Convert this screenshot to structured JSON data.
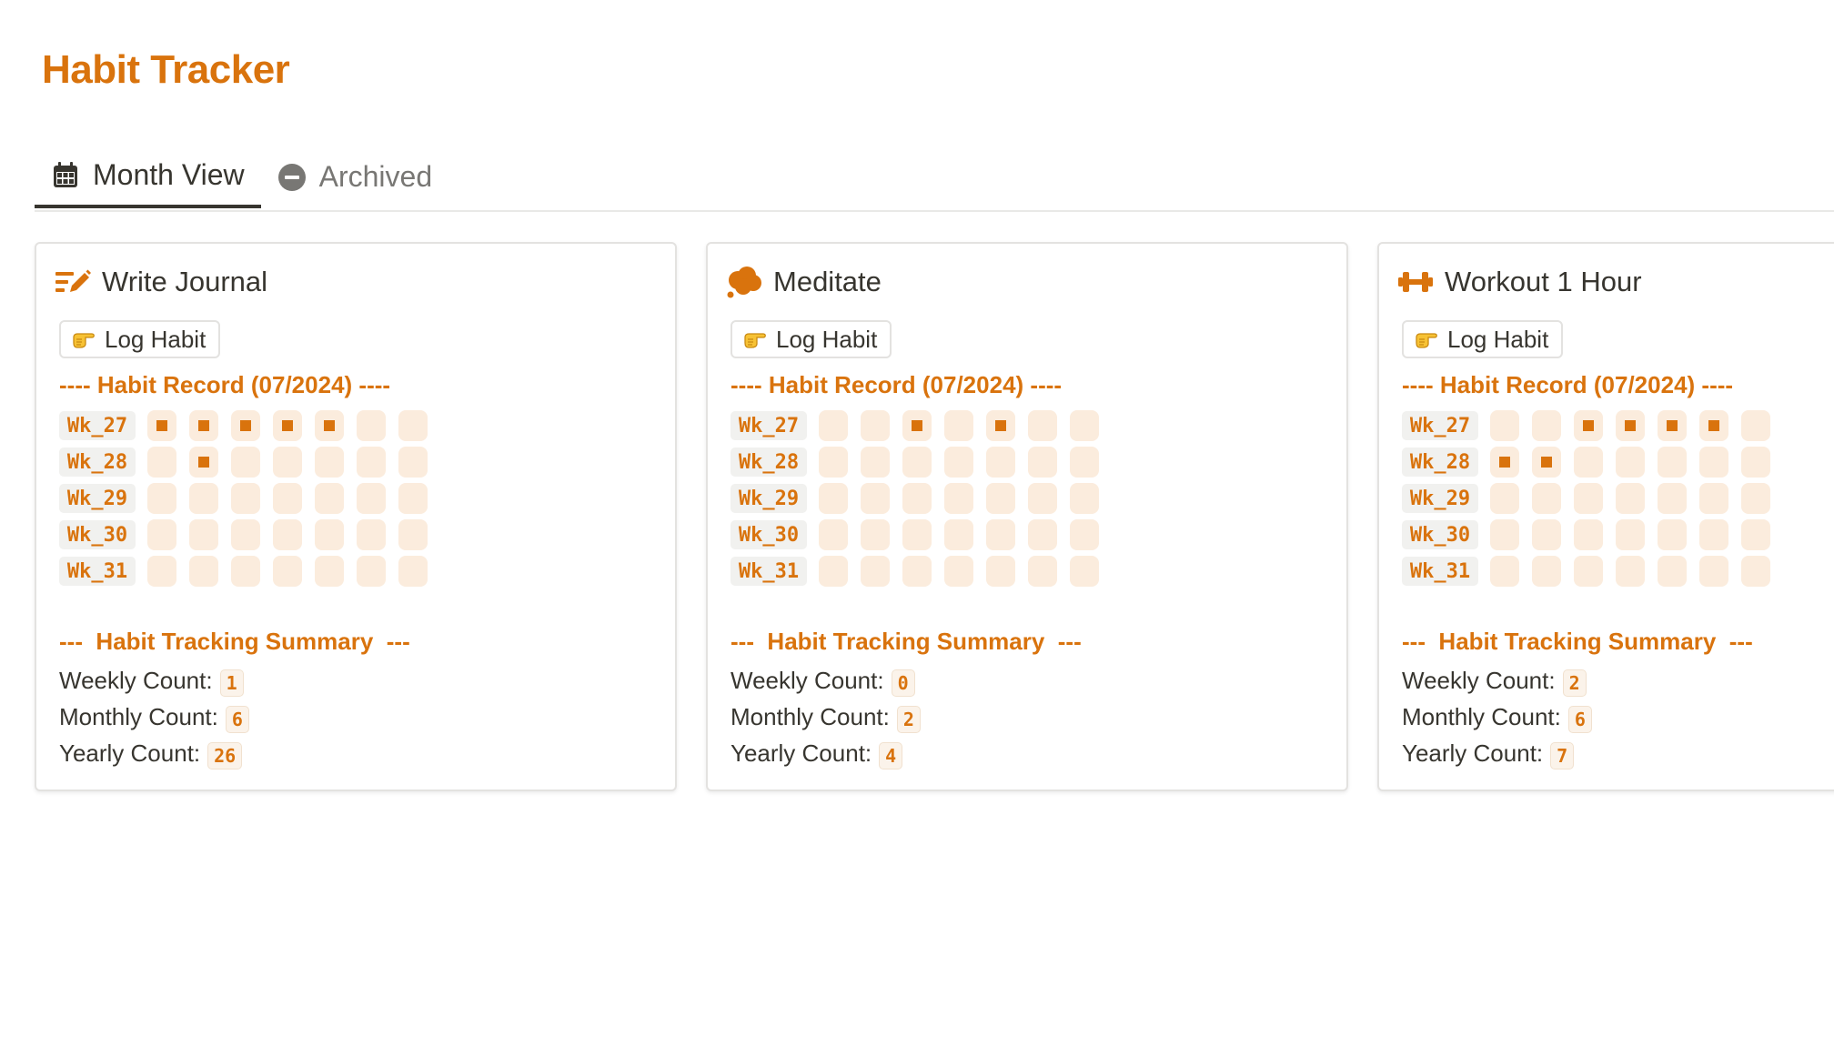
{
  "page": {
    "title": "Habit Tracker",
    "accent_color": "#d9730d",
    "cell_empty_color": "#fbecdd"
  },
  "tabs": [
    {
      "label": "Month View",
      "icon": "calendar-icon",
      "active": true
    },
    {
      "label": "Archived",
      "icon": "minus-circle-icon",
      "active": false
    }
  ],
  "cards": [
    {
      "title": "Write Journal",
      "icon": "pencil-lines-icon",
      "log_button": "Log Habit",
      "record_title": "---- Habit Record (07/2024) ----",
      "weeks": [
        {
          "label": "Wk_27",
          "days": [
            1,
            1,
            1,
            1,
            1,
            0,
            0
          ]
        },
        {
          "label": "Wk_28",
          "days": [
            0,
            1,
            0,
            0,
            0,
            0,
            0
          ]
        },
        {
          "label": "Wk_29",
          "days": [
            0,
            0,
            0,
            0,
            0,
            0,
            0
          ]
        },
        {
          "label": "Wk_30",
          "days": [
            0,
            0,
            0,
            0,
            0,
            0,
            0
          ]
        },
        {
          "label": "Wk_31",
          "days": [
            0,
            0,
            0,
            0,
            0,
            0,
            0
          ]
        }
      ],
      "summary_title": "---  Habit Tracking Summary  ---",
      "weekly_label": "Weekly Count:",
      "weekly_value": "1",
      "monthly_label": "Monthly Count:",
      "monthly_value": "6",
      "yearly_label": "Yearly Count:",
      "yearly_value": "26"
    },
    {
      "title": "Meditate",
      "icon": "cloud-icon",
      "log_button": "Log Habit",
      "record_title": "---- Habit Record (07/2024) ----",
      "weeks": [
        {
          "label": "Wk_27",
          "days": [
            0,
            0,
            1,
            0,
            1,
            0,
            0
          ]
        },
        {
          "label": "Wk_28",
          "days": [
            0,
            0,
            0,
            0,
            0,
            0,
            0
          ]
        },
        {
          "label": "Wk_29",
          "days": [
            0,
            0,
            0,
            0,
            0,
            0,
            0
          ]
        },
        {
          "label": "Wk_30",
          "days": [
            0,
            0,
            0,
            0,
            0,
            0,
            0
          ]
        },
        {
          "label": "Wk_31",
          "days": [
            0,
            0,
            0,
            0,
            0,
            0,
            0
          ]
        }
      ],
      "summary_title": "---  Habit Tracking Summary  ---",
      "weekly_label": "Weekly Count:",
      "weekly_value": "0",
      "monthly_label": "Monthly Count:",
      "monthly_value": "2",
      "yearly_label": "Yearly Count:",
      "yearly_value": "4"
    },
    {
      "title": "Workout 1 Hour",
      "icon": "dumbbell-icon",
      "log_button": "Log Habit",
      "record_title": "---- Habit Record (07/2024) ----",
      "weeks": [
        {
          "label": "Wk_27",
          "days": [
            0,
            0,
            1,
            1,
            1,
            1,
            0
          ]
        },
        {
          "label": "Wk_28",
          "days": [
            1,
            1,
            0,
            0,
            0,
            0,
            0
          ]
        },
        {
          "label": "Wk_29",
          "days": [
            0,
            0,
            0,
            0,
            0,
            0,
            0
          ]
        },
        {
          "label": "Wk_30",
          "days": [
            0,
            0,
            0,
            0,
            0,
            0,
            0
          ]
        },
        {
          "label": "Wk_31",
          "days": [
            0,
            0,
            0,
            0,
            0,
            0,
            0
          ]
        }
      ],
      "summary_title": "---  Habit Tracking Summary  ---",
      "weekly_label": "Weekly Count:",
      "weekly_value": "2",
      "monthly_label": "Monthly Count:",
      "monthly_value": "6",
      "yearly_label": "Yearly Count:",
      "yearly_value": "7"
    }
  ]
}
